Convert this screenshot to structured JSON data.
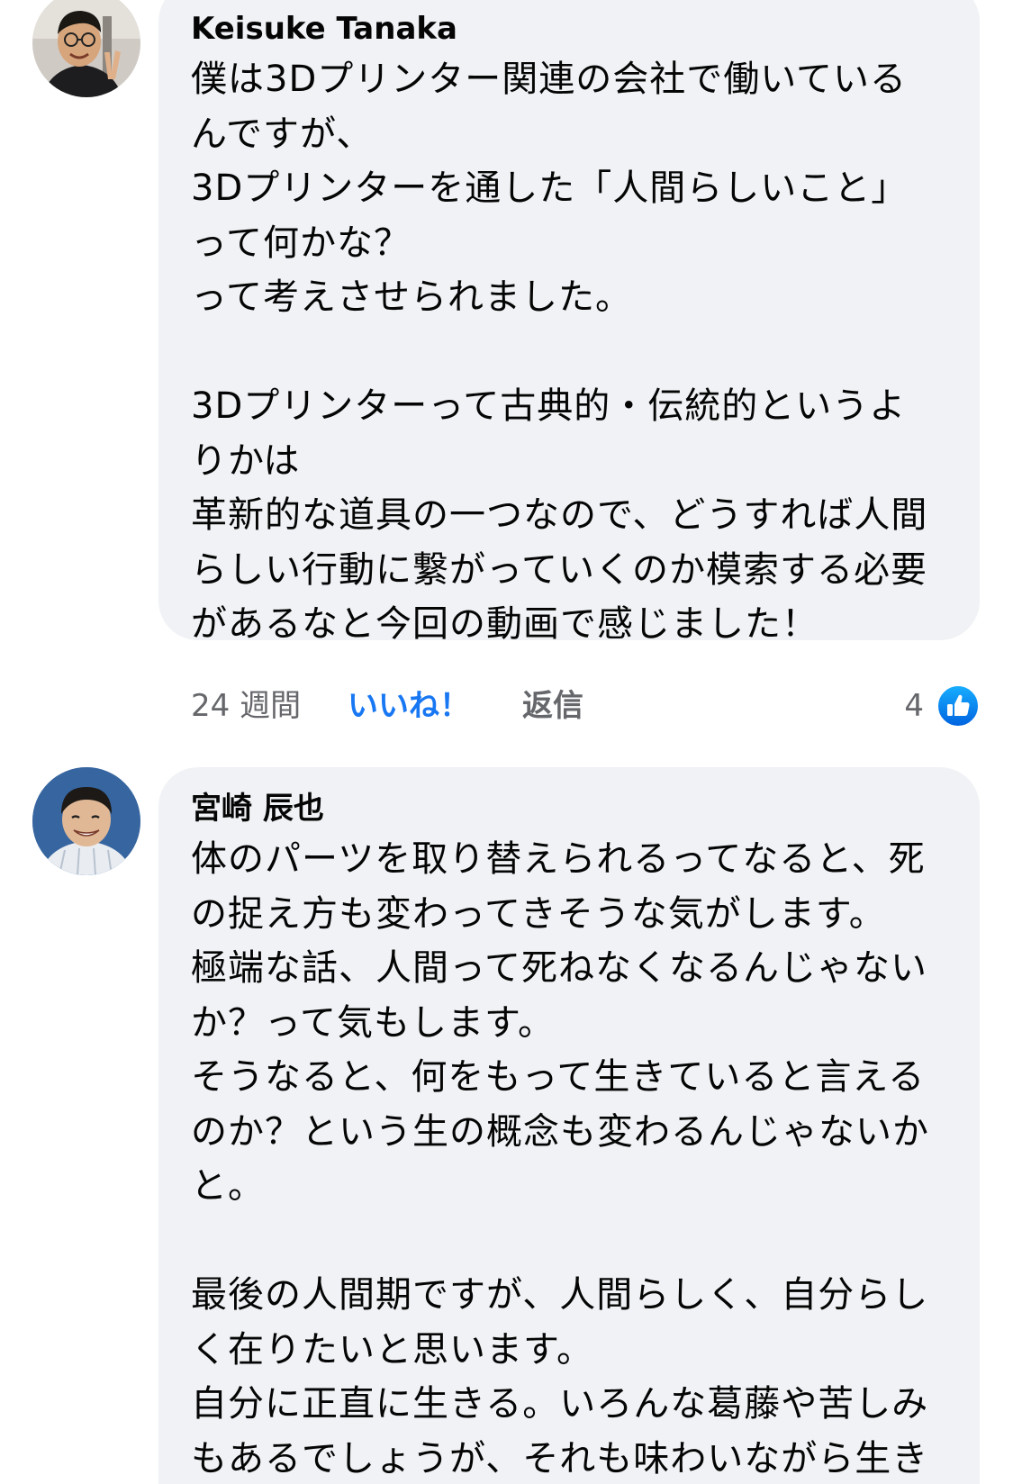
{
  "comments": [
    {
      "author": "Keisuke Tanaka",
      "lines": [
        "僕は3Dプリンター関連の会社で働いている",
        "んですが、",
        "3Dプリンターを通した「人間らしいこと」",
        "って何かな？",
        "って考えさせられました。",
        "",
        "3Dプリンターって古典的・伝統的というよ",
        "りかは",
        "革新的な道具の一つなので、どうすれば人間",
        "らしい行動に繋がっていくのか模索する必要",
        "があるなと今回の動画で感じました！"
      ],
      "time": "24 週間",
      "like_label": "いいね！",
      "reply_label": "返信",
      "reaction_count": "4",
      "reaction_icon": "like-thumbs-up-icon"
    },
    {
      "author": "宮崎 辰也",
      "lines": [
        "体のパーツを取り替えられるってなると、死",
        "の捉え方も変わってきそうな気がします。",
        "極端な話、人間って死ねなくなるんじゃない",
        "か？って気もします。",
        "そうなると、何をもって生きていると言える",
        "のか？という生の概念も変わるんじゃないか",
        "と。",
        "",
        "最後の人間期ですが、人間らしく、自分らし",
        "く在りたいと思います。",
        "自分に正直に生きる。いろんな葛藤や苦しみ",
        "もあるでしょうが、それも味わいながら生き"
      ]
    }
  ],
  "colors": {
    "bubble": "#f0f2f5",
    "link_blue": "#1877f2",
    "meta_gray": "#65676b"
  }
}
